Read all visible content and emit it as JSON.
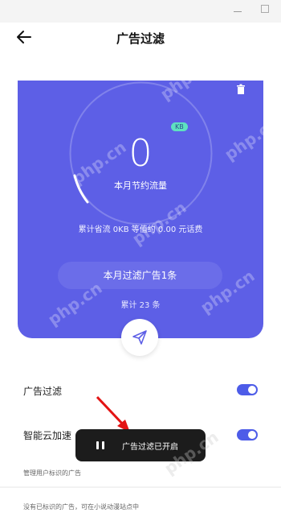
{
  "window": {
    "minimize_label": "—"
  },
  "header": {
    "title": "广告过滤"
  },
  "stats": {
    "value": "0",
    "unit_badge": "KB",
    "month_label": "本月节约流量",
    "saved_line": "累计省流 0KB 等值约 0.00 元话费"
  },
  "filter_pill": {
    "label": "本月过滤广告1条"
  },
  "total_line": "累计 23 条",
  "settings": [
    {
      "label": "广告过滤",
      "enabled": true
    },
    {
      "label": "智能云加速",
      "enabled": true
    }
  ],
  "descriptions": {
    "manage": "管理用户标识的广告",
    "unlabeled": "没有已标识的广告，可在小说动漫站点中"
  },
  "toast": {
    "text": "广告过滤已开启"
  },
  "watermark": "php.cn",
  "colors": {
    "accent": "#5d5fe6",
    "badge": "#5ee2c0",
    "toggle": "#4d5ce8",
    "toast_bg": "#1c1c1c"
  },
  "icons": {
    "back": "arrow-left-icon",
    "trash": "trash-icon",
    "send": "paper-plane-icon",
    "pause": "pause-icon"
  }
}
